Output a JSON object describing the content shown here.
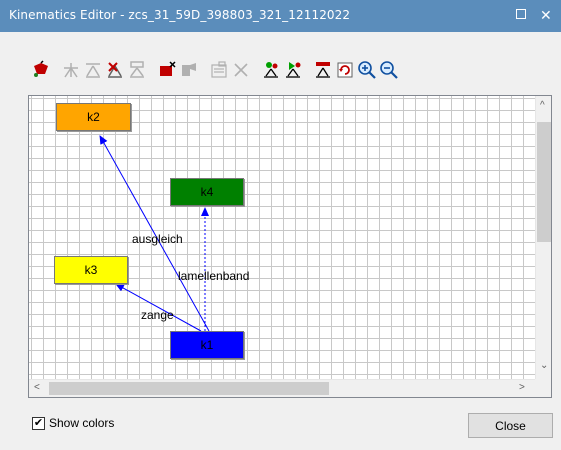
{
  "window": {
    "title": "Kinematics Editor -  zcs_31_59D_398803_321_12112022"
  },
  "toolbar": {
    "tools": [
      "add-node-icon",
      "link-icon",
      "unlink-icon",
      "edit-link-icon",
      "link-list-icon",
      "delete-node-icon",
      "hierarchy-icon",
      "properties-icon",
      "delete-icon",
      "layout-icon",
      "layout-auto-icon",
      "tree-icon",
      "refresh-icon",
      "zoom-in-icon",
      "zoom-out-icon"
    ]
  },
  "diagram": {
    "nodes": [
      {
        "id": "k2",
        "label": "k2",
        "color": "#ffa500"
      },
      {
        "id": "k4",
        "label": "k4",
        "color": "#008000"
      },
      {
        "id": "k3",
        "label": "k3",
        "color": "#ffff00"
      },
      {
        "id": "k1",
        "label": "k1",
        "color": "#0000ff"
      }
    ],
    "edges": [
      {
        "from": "k1",
        "to": "k2",
        "label": "ausgleich",
        "style": "solid"
      },
      {
        "from": "k1",
        "to": "k4",
        "label": "lamellenband",
        "style": "dotted"
      },
      {
        "from": "k1",
        "to": "k3",
        "label": "zange",
        "style": "solid"
      }
    ],
    "edge_color": "#0000ff"
  },
  "footer": {
    "show_colors_label": "Show colors",
    "show_colors_checked": true,
    "checkmark": "✔",
    "close_label": "Close"
  },
  "scroll": {
    "up_arrow": "^",
    "down_arrow": "⌄",
    "left_arrow": "<",
    "right_arrow": ">"
  }
}
